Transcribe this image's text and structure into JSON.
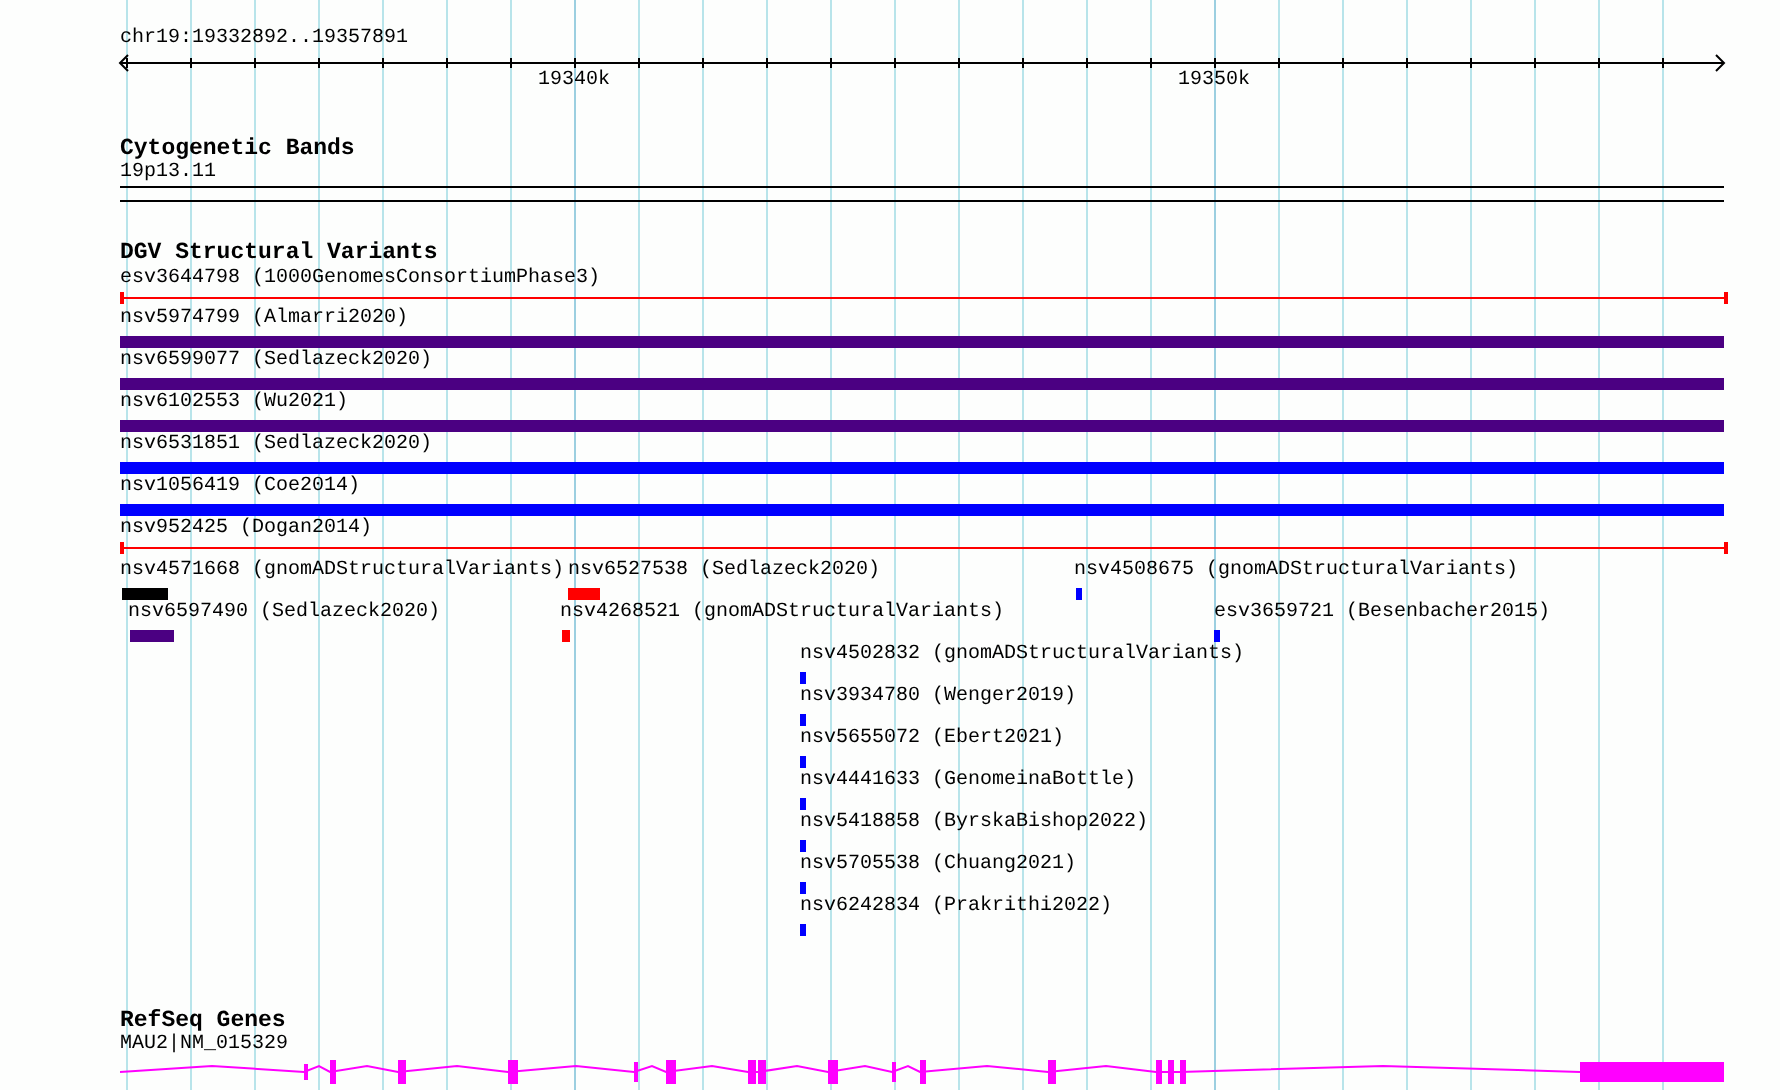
{
  "ruler": {
    "location": "chr19:19332892..19357891",
    "ticks": [
      "19340k",
      "19350k"
    ]
  },
  "cytogenetic_bands": {
    "title": "Cytogenetic Bands",
    "band": "19p13.11"
  },
  "dgv": {
    "title": "DGV Structural Variants",
    "features": [
      {
        "label": "esv3644798 (1000GenomesConsortiumPhase3)",
        "kind": "line",
        "color": "#ff0000"
      },
      {
        "label": "nsv5974799 (Almarri2020)",
        "kind": "bar",
        "color": "#4b0082"
      },
      {
        "label": "nsv6599077 (Sedlazeck2020)",
        "kind": "bar",
        "color": "#4b0082"
      },
      {
        "label": "nsv6102553 (Wu2021)",
        "kind": "bar",
        "color": "#4b0082"
      },
      {
        "label": "nsv6531851 (Sedlazeck2020)",
        "kind": "bar",
        "color": "#0000ff"
      },
      {
        "label": "nsv1056419 (Coe2014)",
        "kind": "bar",
        "color": "#0000ff"
      },
      {
        "label": "nsv952425 (Dogan2014)",
        "kind": "line",
        "color": "#ff0000"
      },
      {
        "label": "nsv4571668 (gnomADStructuralVariants)",
        "kind": "bar",
        "color": "#000000"
      },
      {
        "label": "nsv6527538 (Sedlazeck2020)",
        "kind": "bar",
        "color": "#ff0000"
      },
      {
        "label": "nsv4508675 (gnomADStructuralVariants)",
        "kind": "bar",
        "color": "#0000ff"
      },
      {
        "label": "nsv6597490 (Sedlazeck2020)",
        "kind": "bar",
        "color": "#4b0082"
      },
      {
        "label": "nsv4268521 (gnomADStructuralVariants)",
        "kind": "bar",
        "color": "#ff0000"
      },
      {
        "label": "esv3659721 (Besenbacher2015)",
        "kind": "bar",
        "color": "#0000ff"
      },
      {
        "label": "nsv4502832 (gnomADStructuralVariants)",
        "kind": "bar",
        "color": "#0000ff"
      },
      {
        "label": "nsv3934780 (Wenger2019)",
        "kind": "bar",
        "color": "#0000ff"
      },
      {
        "label": "nsv5655072 (Ebert2021)",
        "kind": "bar",
        "color": "#0000ff"
      },
      {
        "label": "nsv4441633 (GenomeinaBottle)",
        "kind": "bar",
        "color": "#0000ff"
      },
      {
        "label": "nsv5418858 (ByrskaBishop2022)",
        "kind": "bar",
        "color": "#0000ff"
      },
      {
        "label": "nsv5705538 (Chuang2021)",
        "kind": "bar",
        "color": "#0000ff"
      },
      {
        "label": "nsv6242834 (Prakrithi2022)",
        "kind": "bar",
        "color": "#0000ff"
      }
    ]
  },
  "refseq": {
    "title": "RefSeq Genes",
    "gene": "MAU2|NM_015329"
  }
}
